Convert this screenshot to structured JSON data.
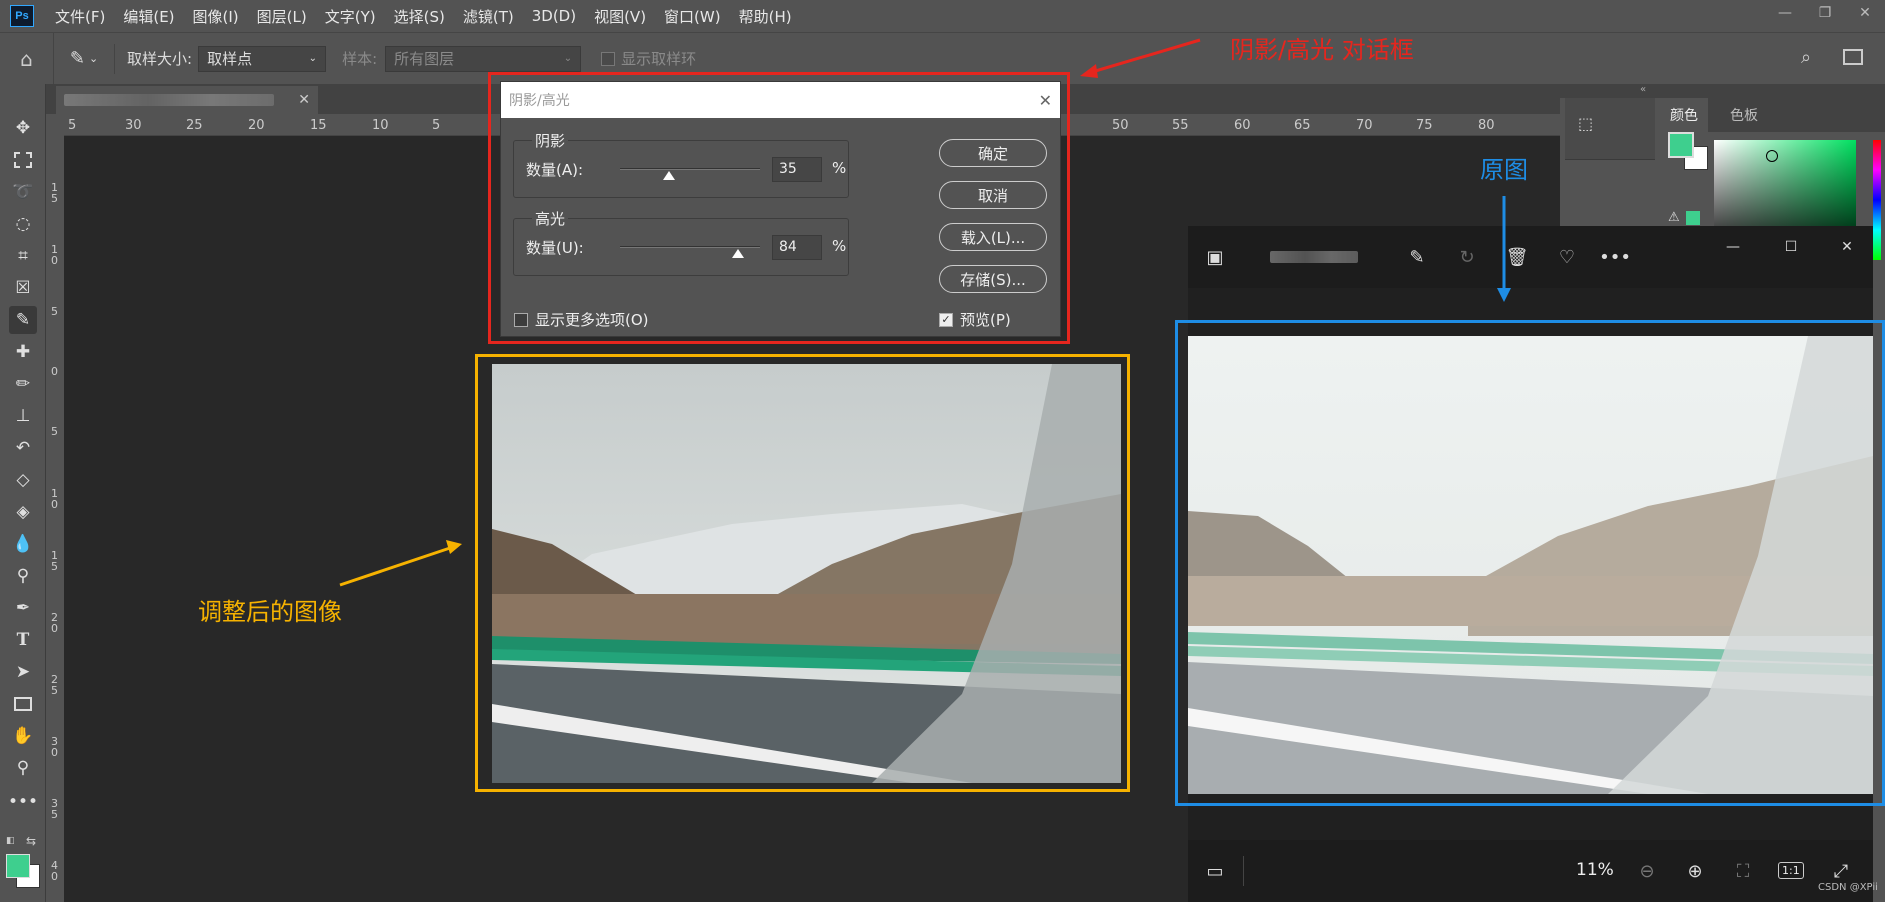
{
  "app": {
    "logo": "Ps"
  },
  "menubar": {
    "items": [
      "文件(F)",
      "编辑(E)",
      "图像(I)",
      "图层(L)",
      "文字(Y)",
      "选择(S)",
      "滤镜(T)",
      "3D(D)",
      "视图(V)",
      "窗口(W)",
      "帮助(H)"
    ]
  },
  "options": {
    "sample_size_label": "取样大小:",
    "sample_size_value": "取样点",
    "sample_label": "样本:",
    "sample_value": "所有图层",
    "show_ring_label": "显示取样环"
  },
  "ruler": {
    "h_ticks": [
      "5",
      "30",
      "25",
      "20",
      "15",
      "10",
      "5",
      "50",
      "55",
      "60",
      "65",
      "70",
      "75",
      "80"
    ],
    "v_ticks": [
      "1\n5",
      "1\n0",
      "5",
      "0",
      "5",
      "1\n0",
      "1\n5",
      "2\n0",
      "2\n5",
      "3\n0",
      "3\n5",
      "4\n0"
    ]
  },
  "panels": {
    "color_tab": "颜色",
    "swatches_tab": "色板"
  },
  "colors": {
    "foreground": "#3ecf8e",
    "background": "#ffffff",
    "dialog_highlight": "#e5261e",
    "adjusted_highlight": "#f6b200",
    "original_highlight": "#1e8de5"
  },
  "dialog": {
    "title": "阴影/高光",
    "shadows": {
      "group_title": "阴影",
      "amount_label": "数量(A):",
      "amount_value": "35",
      "unit": "%",
      "slider_fraction": 0.35
    },
    "highlights": {
      "group_title": "高光",
      "amount_label": "数量(U):",
      "amount_value": "84",
      "unit": "%",
      "slider_fraction": 0.84
    },
    "buttons": {
      "ok": "确定",
      "cancel": "取消",
      "load": "载入(L)...",
      "save": "存储(S)..."
    },
    "more_options_label": "显示更多选项(O)",
    "preview_label": "预览(P)"
  },
  "viewer": {
    "zoom": "11%",
    "ratio": "1:1"
  },
  "annotations": {
    "dialog_label": "阴影/高光 对话框",
    "original_label": "原图",
    "adjusted_label": "调整后的图像"
  },
  "watermark": "CSDN @XPii"
}
